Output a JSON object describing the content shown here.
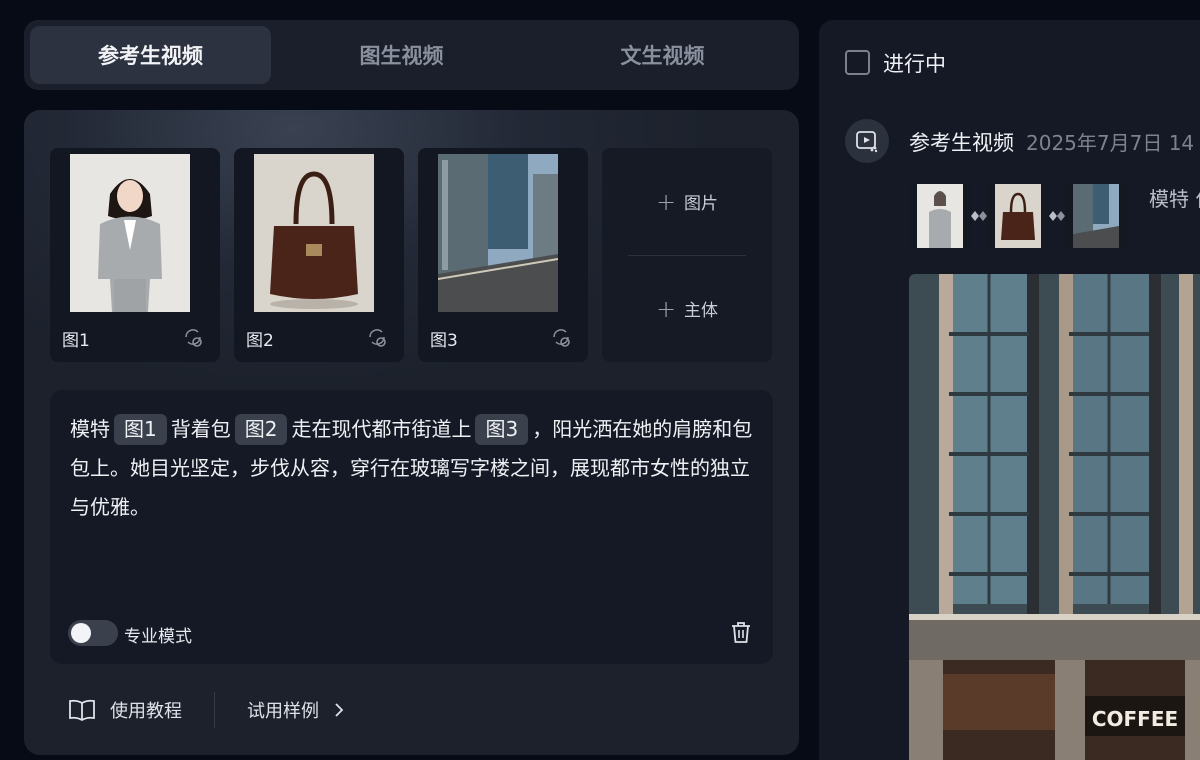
{
  "tabs": [
    {
      "label": "参考生视频",
      "active": true
    },
    {
      "label": "图生视频",
      "active": false
    },
    {
      "label": "文生视频",
      "active": false
    }
  ],
  "references": [
    {
      "caption": "图1",
      "subject": "woman-in-grey-suit"
    },
    {
      "caption": "图2",
      "subject": "brown-leather-handbag"
    },
    {
      "caption": "图3",
      "subject": "city-street"
    }
  ],
  "add": {
    "image_label": "图片",
    "subject_label": "主体"
  },
  "prompt": {
    "seg1": "模特",
    "chip1": "图1",
    "seg2": "背着包",
    "chip2": "图2",
    "seg3": "走在现代都市街道上",
    "chip3": "图3",
    "seg4": "，阳光洒在她的肩膀和包包上。她目光坚定，步伐从容，穿行在玻璃写字楼之间，展现都市女性的独立与优雅。"
  },
  "pro_mode": {
    "label": "专业模式",
    "enabled": false
  },
  "footer": {
    "tutorial_label": "使用教程",
    "examples_label": "试用样例"
  },
  "right": {
    "status_label": "进行中",
    "task": {
      "title": "参考生视频",
      "time": "2025年7月7日 14",
      "prompt_preview": "模特 伐从容"
    },
    "video_sign": "COFFEE"
  },
  "colors": {
    "background": "#060b16",
    "panel": "#1c212c",
    "chip": "#3a404c"
  }
}
